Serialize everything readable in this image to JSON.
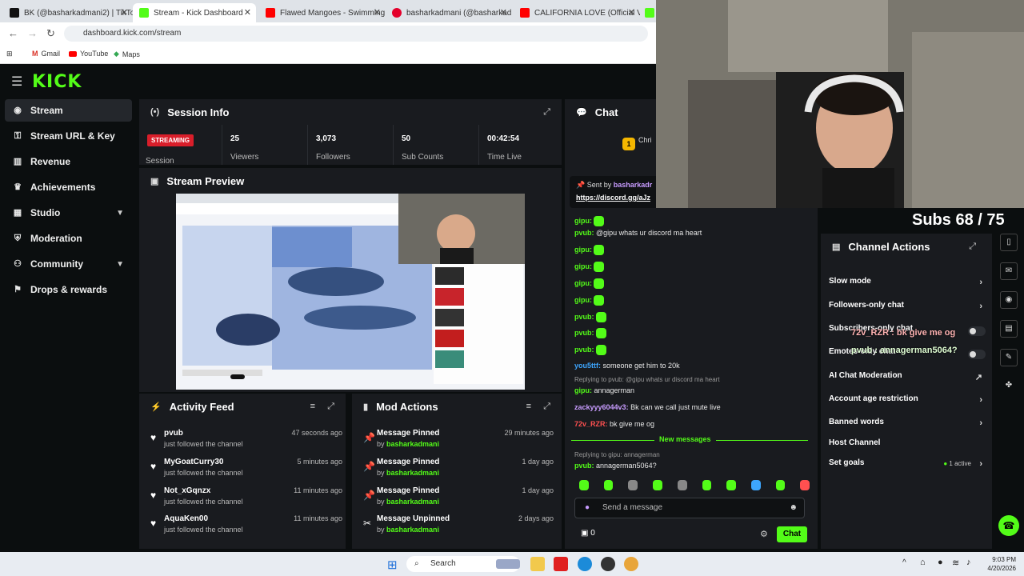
{
  "browser": {
    "tabs": [
      {
        "title": "BK (@basharkadmani2) | TikTok",
        "color": "#111111"
      },
      {
        "title": "Stream - Kick Dashboard",
        "color": "#53fc18"
      },
      {
        "title": "Flawed Mangoes - Swimming -",
        "color": "#ff0000"
      },
      {
        "title": "basharkadmani (@basharkadm",
        "color": "#e4002b"
      },
      {
        "title": "CALIFORNIA LOVE (Official Vid",
        "color": "#ff0000"
      }
    ],
    "url": "dashboard.kick.com/stream",
    "bookmarks": [
      "Gmail",
      "YouTube",
      "Maps"
    ]
  },
  "brand": {
    "logo": "KICK"
  },
  "sidebar": {
    "items": [
      {
        "label": "Stream",
        "icon": "broadcast-icon"
      },
      {
        "label": "Stream URL & Key",
        "icon": "key-icon"
      },
      {
        "label": "Revenue",
        "icon": "chart-icon"
      },
      {
        "label": "Achievements",
        "icon": "trophy-icon"
      },
      {
        "label": "Studio",
        "icon": "studio-icon"
      },
      {
        "label": "Moderation",
        "icon": "shield-icon"
      },
      {
        "label": "Community",
        "icon": "people-icon"
      },
      {
        "label": "Drops & rewards",
        "icon": "gift-icon"
      }
    ]
  },
  "session": {
    "title": "Session Info",
    "badge": "STREAMING",
    "badge_label": "Session",
    "stats": [
      {
        "value": "25",
        "label": "Viewers"
      },
      {
        "value": "3,073",
        "label": "Followers"
      },
      {
        "value": "50",
        "label": "Sub Counts"
      },
      {
        "value": "00:42:54",
        "label": "Time Live"
      }
    ]
  },
  "preview": {
    "title": "Stream Preview"
  },
  "activity": {
    "title": "Activity Feed",
    "items": [
      {
        "name": "pvub",
        "sub": "just followed the channel",
        "time": "47 seconds ago"
      },
      {
        "name": "MyGoatCurry30",
        "sub": "just followed the channel",
        "time": "5 minutes ago"
      },
      {
        "name": "Not_xGqnzx",
        "sub": "just followed the channel",
        "time": "11 minutes ago"
      },
      {
        "name": "AquaKen00",
        "sub": "just followed the channel",
        "time": "11 minutes ago"
      }
    ]
  },
  "mod": {
    "title": "Mod Actions",
    "items": [
      {
        "action": "Message Pinned",
        "by": "by",
        "user": "basharkadmani",
        "time": "29 minutes ago"
      },
      {
        "action": "Message Pinned",
        "by": "by",
        "user": "basharkadmani",
        "time": "1 day ago"
      },
      {
        "action": "Message Pinned",
        "by": "by",
        "user": "basharkadmani",
        "time": "1 day ago"
      },
      {
        "action": "Message Unpinned",
        "by": "by",
        "user": "basharkadmani",
        "time": "2 days ago"
      }
    ]
  },
  "chat": {
    "title": "Chat",
    "pinned_sent_by": "Sent by",
    "pinned_user": "basharkadr",
    "pinned_link": "https://discord.gg/aJz",
    "top_user_short": "Chri",
    "top_badge_count": "1",
    "messages": [
      {
        "user": "pvub:",
        "text": "@gipu whats ur discord ma heart"
      },
      {
        "user": "gipu:",
        "text": ""
      },
      {
        "user": "gipu:",
        "text": ""
      },
      {
        "user": "gipu:",
        "text": ""
      },
      {
        "user": "gipu:",
        "text": ""
      },
      {
        "user": "pvub:",
        "text": ""
      },
      {
        "user": "pvub:",
        "text": ""
      },
      {
        "user": "pvub:",
        "text": ""
      },
      {
        "user": "you5ttf:",
        "text": "someone get him to 20k"
      },
      {
        "user": "gipu:",
        "text": "annagerman"
      },
      {
        "user": "zackyyy6044v3:",
        "text": "Bk can we call just mute live"
      },
      {
        "user": "72v_RZR:",
        "text": "bk give me og"
      },
      {
        "user": "pvub:",
        "text": "annagerman5064?"
      }
    ],
    "reply1": "Replying to pvub: @gipu whats ur discord ma heart",
    "reply2": "Replying to gipu: annagerman",
    "new_messages": "New messages",
    "input_placeholder": "Send a message",
    "count": "0",
    "send_label": "Chat"
  },
  "channel_actions": {
    "title": "Channel Actions",
    "overlay": "Subs 68 / 75",
    "items": [
      {
        "label": "Slow mode"
      },
      {
        "label": "Followers-only chat"
      },
      {
        "label": "Subscribers-only chat"
      },
      {
        "label": "Emotes-only chat"
      },
      {
        "label": "AI Chat Moderation"
      },
      {
        "label": "Account age restriction"
      },
      {
        "label": "Banned words"
      },
      {
        "label": "Host Channel"
      },
      {
        "label": "Set goals"
      }
    ],
    "goals_status": "1 active",
    "overlay_chat1": "72v_RZR : bk give me og",
    "overlay_chat2": "pvub : annagerman5064?"
  },
  "taskbar": {
    "search_placeholder": "Search",
    "time": "9:03 PM",
    "date": "4/20/2026"
  },
  "colors": {
    "accent": "#53fc18",
    "live": "#d91e2a",
    "panel": "#191b1f"
  }
}
